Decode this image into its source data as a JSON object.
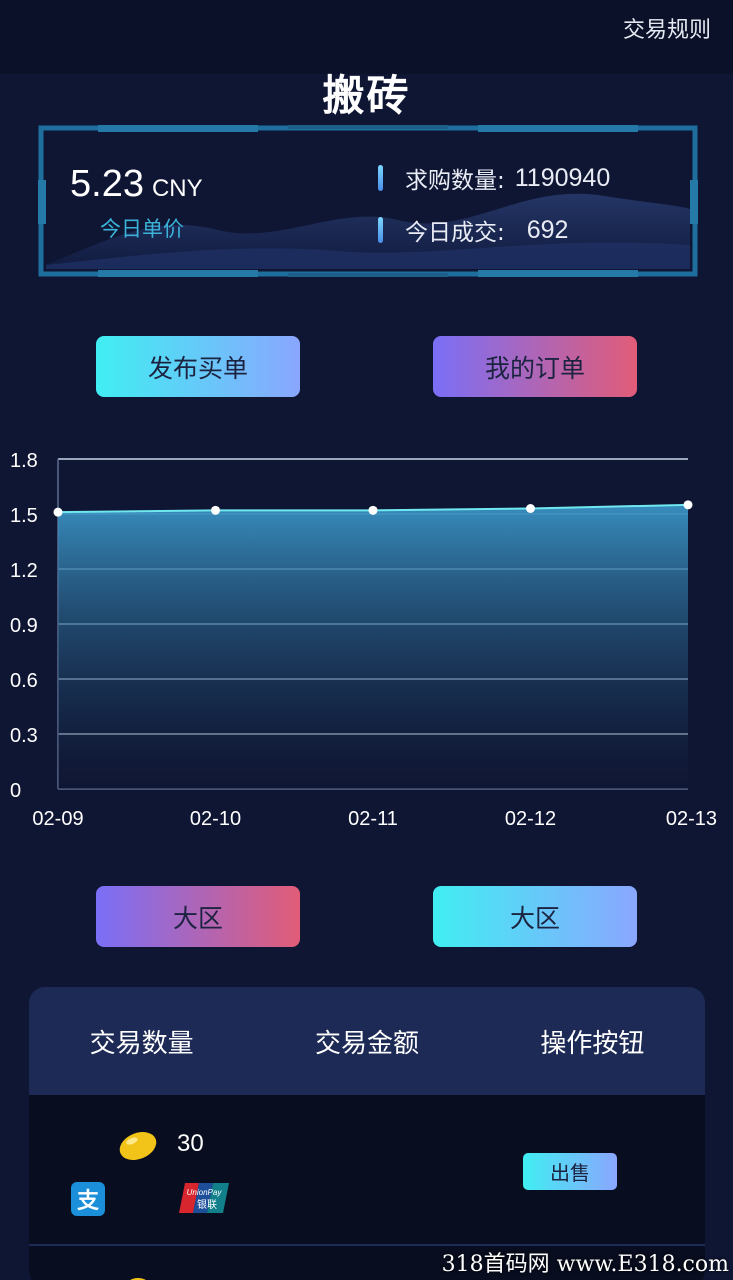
{
  "header": {
    "rules_label": "交易规则",
    "title": "搬砖"
  },
  "stats": {
    "price_value": "5.23",
    "price_unit": "CNY",
    "price_label": "今日单价",
    "buy_qty_label": "求购数量:",
    "buy_qty_value": "1190940",
    "today_deal_label": "今日成交:",
    "today_deal_value": "692"
  },
  "actions": {
    "publish_label": "发布买单",
    "my_orders_label": "我的订单"
  },
  "zones": {
    "left_label": "大区",
    "right_label": "大区"
  },
  "chart_data": {
    "type": "area",
    "x": [
      "02-09",
      "02-10",
      "02-11",
      "02-12",
      "02-13"
    ],
    "series": [
      {
        "values": [
          1.51,
          1.52,
          1.52,
          1.53,
          1.55
        ]
      }
    ],
    "ylim": [
      0,
      1.8
    ],
    "yticks": [
      "0",
      "0.3",
      "0.6",
      "0.9",
      "1.2",
      "1.5",
      "1.8"
    ],
    "grid": true
  },
  "table": {
    "headers": [
      "交易数量",
      "交易金额",
      "操作按钮"
    ],
    "rows": [
      {
        "quantity": "30",
        "amount": "",
        "action": "出售",
        "payment_icons": [
          "alipay-icon",
          "unionpay-icon"
        ]
      }
    ]
  },
  "icons": {
    "alipay_glyph": "支",
    "unionpay_text": "UnionPay",
    "unionpay_cn": "银联"
  },
  "watermark": "318首码网 www.E318.com",
  "colors": {
    "accent_cyan": "#40eef2",
    "accent_purple": "#7a6ff7",
    "accent_red": "#e15c78",
    "background": "#0f1633"
  }
}
